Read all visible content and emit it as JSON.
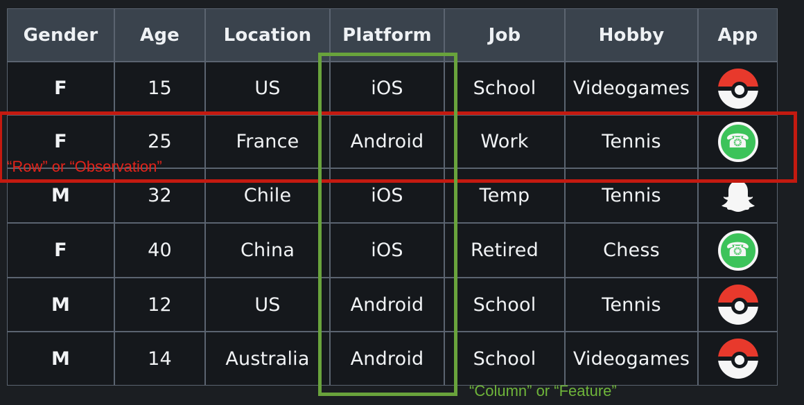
{
  "table": {
    "headers": [
      "Gender",
      "Age",
      "Location",
      "Platform",
      "Job",
      "Hobby",
      "App"
    ],
    "rows": [
      {
        "gender": "F",
        "age": "15",
        "location": "US",
        "platform": "iOS",
        "job": "School",
        "hobby": "Videogames",
        "app": "pokeball-icon"
      },
      {
        "gender": "F",
        "age": "25",
        "location": "France",
        "platform": "Android",
        "job": "Work",
        "hobby": "Tennis",
        "app": "whatsapp-icon"
      },
      {
        "gender": "M",
        "age": "32",
        "location": "Chile",
        "platform": "iOS",
        "job": "Temp",
        "hobby": "Tennis",
        "app": "snapchat-icon"
      },
      {
        "gender": "F",
        "age": "40",
        "location": "China",
        "platform": "iOS",
        "job": "Retired",
        "hobby": "Chess",
        "app": "whatsapp-icon"
      },
      {
        "gender": "M",
        "age": "12",
        "location": "US",
        "platform": "Android",
        "job": "School",
        "hobby": "Tennis",
        "app": "pokeball-icon"
      },
      {
        "gender": "M",
        "age": "14",
        "location": "Australia",
        "platform": "Android",
        "job": "School",
        "hobby": "Videogames",
        "app": "pokeball-icon"
      }
    ]
  },
  "annotations": {
    "row_label": "“Row” or “Observation”",
    "column_label": "“Column” or “Feature”",
    "row_color": "#c41a10",
    "column_color": "#69a33c"
  }
}
